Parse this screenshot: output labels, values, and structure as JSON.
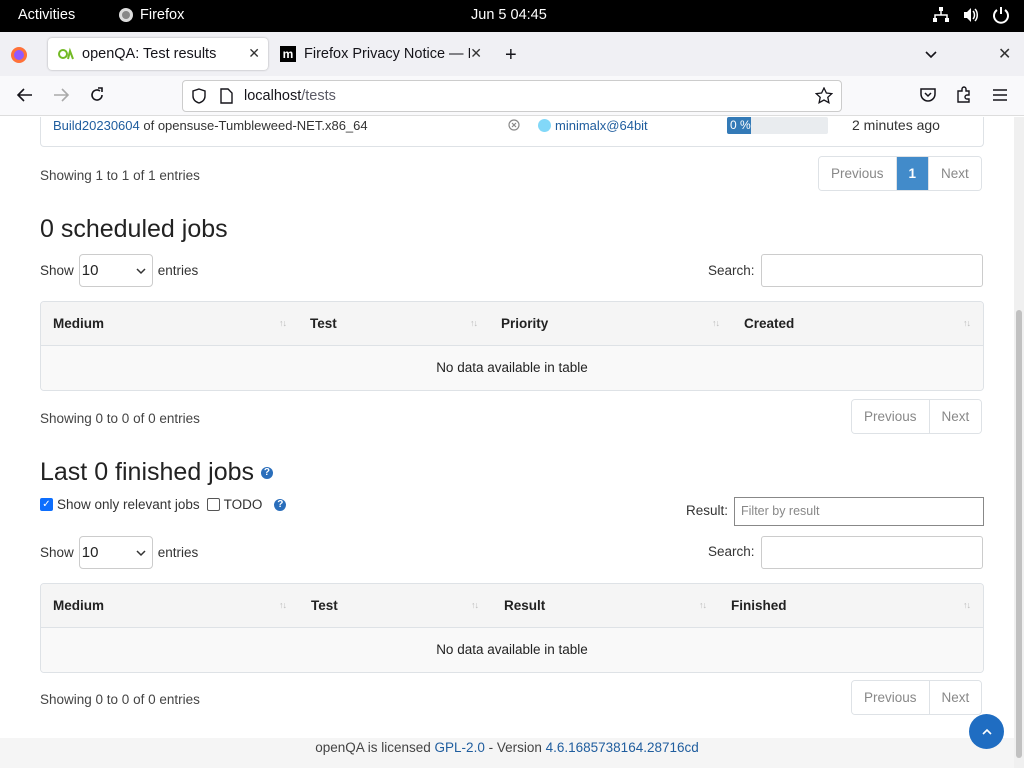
{
  "system": {
    "activities": "Activities",
    "app_name": "Firefox",
    "clock": "Jun 5  04:45"
  },
  "browser": {
    "tabs": [
      {
        "title": "openQA: Test results",
        "active": true
      },
      {
        "title": "Firefox Privacy Notice — M",
        "active": false
      }
    ],
    "url_host": "localhost",
    "url_path": "/tests"
  },
  "running": {
    "build_link": "Build20230604",
    "build_rest": " of opensuse-Tumbleweed-NET.x86_64",
    "worker": "minimalx@64bit",
    "progress_label": "0 %",
    "progress": 0,
    "ago": "2 minutes ago",
    "info": "Showing 1 to 1 of 1 entries",
    "pager": {
      "prev": "Previous",
      "page": "1",
      "next": "Next"
    }
  },
  "scheduled": {
    "heading": "0 scheduled jobs",
    "show_label": "Show",
    "length_value": "10",
    "entries_label": "entries",
    "search_label": "Search:",
    "columns": [
      "Medium",
      "Test",
      "Priority",
      "Created"
    ],
    "empty": "No data available in table",
    "info": "Showing 0 to 0 of 0 entries",
    "pager": {
      "prev": "Previous",
      "next": "Next"
    }
  },
  "finished": {
    "heading": "Last 0 finished jobs",
    "relevant_label": "Show only relevant jobs",
    "todo_label": "TODO",
    "result_label": "Result:",
    "result_placeholder": "Filter by result",
    "show_label": "Show",
    "length_value": "10",
    "entries_label": "entries",
    "search_label": "Search:",
    "columns": [
      "Medium",
      "Test",
      "Result",
      "Finished"
    ],
    "empty": "No data available in table",
    "info": "Showing 0 to 0 of 0 entries",
    "pager": {
      "prev": "Previous",
      "next": "Next"
    }
  },
  "footer": {
    "text": "openQA is licensed ",
    "license": "GPL-2.0",
    "sep": " - Version ",
    "version": "4.6.1685738164.28716cd"
  },
  "colors": {
    "accent": "#428bca",
    "link": "#1f5d9e",
    "progress": "#337ab7"
  }
}
